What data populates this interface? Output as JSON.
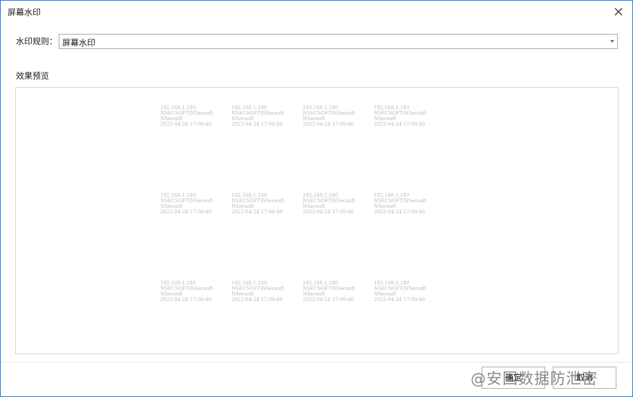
{
  "window": {
    "title": "屏幕水印"
  },
  "rule": {
    "label": "水印规则：",
    "selected": "屏幕水印"
  },
  "preview": {
    "label": "效果预览",
    "tile": {
      "ip": "192.168.1.180",
      "user": "NSECSOFT\\NSecsoft",
      "name": "NSecsoft",
      "datetime": "2022-04-24 17:00:40"
    }
  },
  "footer": {
    "ok_label": "确定",
    "cancel_label": "取消"
  },
  "overlay": {
    "text": "@安国数据防泄密"
  },
  "colors": {
    "window_border": "#3c6fa8",
    "watermark_text": "#b9b9b9"
  }
}
